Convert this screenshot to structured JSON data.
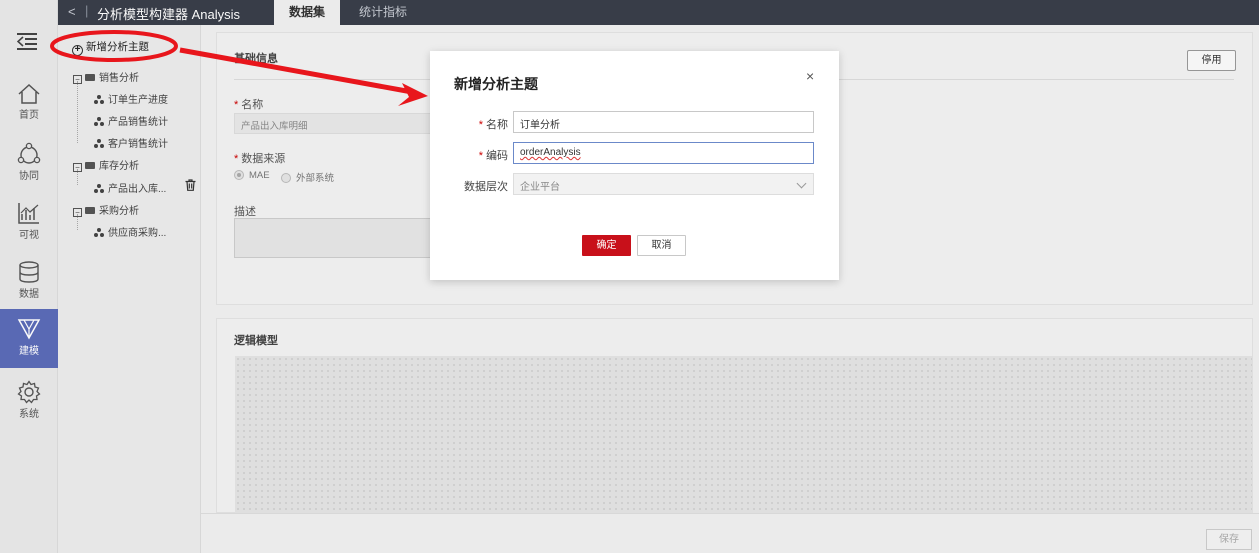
{
  "app": {
    "title": "分析模型构建器 Analysis",
    "back_glyph": "<",
    "separator": "|"
  },
  "top_tabs": [
    {
      "label": "数据集",
      "active": true
    },
    {
      "label": "统计指标",
      "active": false
    }
  ],
  "rail": {
    "items": [
      {
        "label": "首页",
        "icon": "home-icon"
      },
      {
        "label": "协同",
        "icon": "collaboration-icon"
      },
      {
        "label": "可视",
        "icon": "chart-icon"
      },
      {
        "label": "数据",
        "icon": "database-icon"
      },
      {
        "label": "建模",
        "icon": "modeling-icon",
        "active": true
      },
      {
        "label": "系统",
        "icon": "gear-icon"
      }
    ]
  },
  "tree": {
    "add_label": "新增分析主题",
    "groups": [
      {
        "label": "销售分析",
        "items": [
          "订单生产进度",
          "产品销售统计",
          "客户销售统计"
        ]
      },
      {
        "label": "库存分析",
        "items": [
          "产品出入库..."
        ]
      },
      {
        "label": "采购分析",
        "items": [
          "供应商采购..."
        ]
      }
    ]
  },
  "form": {
    "section_title": "基础信息",
    "stop_button": "停用",
    "name_label": "名称",
    "name_value": "产品出入库明细",
    "source_label": "数据来源",
    "source_options": [
      "MAE",
      "外部系统"
    ],
    "desc_label": "描述"
  },
  "logic": {
    "section_title": "逻辑模型"
  },
  "footer": {
    "save_button": "保存"
  },
  "modal": {
    "title": "新增分析主题",
    "close_glyph": "×",
    "name_label": "名称",
    "name_value": "订单分析",
    "code_label": "编码",
    "code_value": "orderAnalysis",
    "level_label": "数据层次",
    "level_value": "企业平台",
    "ok_button": "确定",
    "cancel_button": "取消"
  },
  "colors": {
    "topbar": "#3a3f4a",
    "active_nav": "#5b6cb8",
    "primary_button": "#c8101a",
    "annotation": "#e8161c"
  }
}
